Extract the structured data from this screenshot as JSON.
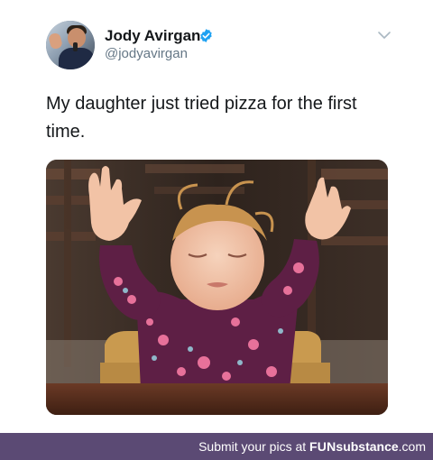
{
  "tweet": {
    "user": {
      "display_name": "Jody Avirgan",
      "handle": "@jodyavirgan",
      "verified": true,
      "avatar_icon": "user-avatar"
    },
    "menu_icon": "chevron-down-icon",
    "text": "My daughter just tried pizza for the first time.",
    "photo_description_icon": "photo"
  },
  "footer": {
    "prefix": "Submit your pics at ",
    "brand_part1": "FUN",
    "brand_part2": "substance",
    "brand_part3": ".com"
  },
  "colors": {
    "verified": "#1da1f2",
    "footer_bg": "#5b4a74",
    "handle": "#657786"
  }
}
